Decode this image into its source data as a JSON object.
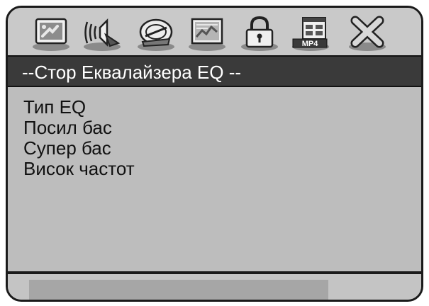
{
  "toolbar": {
    "icons": [
      {
        "name": "system-setup-icon"
      },
      {
        "name": "audio-setup-icon"
      },
      {
        "name": "video-setup-icon"
      },
      {
        "name": "display-setup-icon"
      },
      {
        "name": "lock-icon"
      },
      {
        "name": "mp4-icon",
        "label": "MP4"
      },
      {
        "name": "exit-icon"
      }
    ]
  },
  "title": "--Стор Еквалайзера EQ --",
  "menu": {
    "items": [
      "Тип EQ",
      "Посил бас",
      "Супер бас",
      "Висок частот"
    ]
  },
  "footer": {
    "status": ""
  },
  "colors": {
    "background": "#bdbdbd",
    "titlebar": "#3a3a3a",
    "title_text": "#ffffff",
    "text": "#111111",
    "border": "#1a1a1a"
  }
}
